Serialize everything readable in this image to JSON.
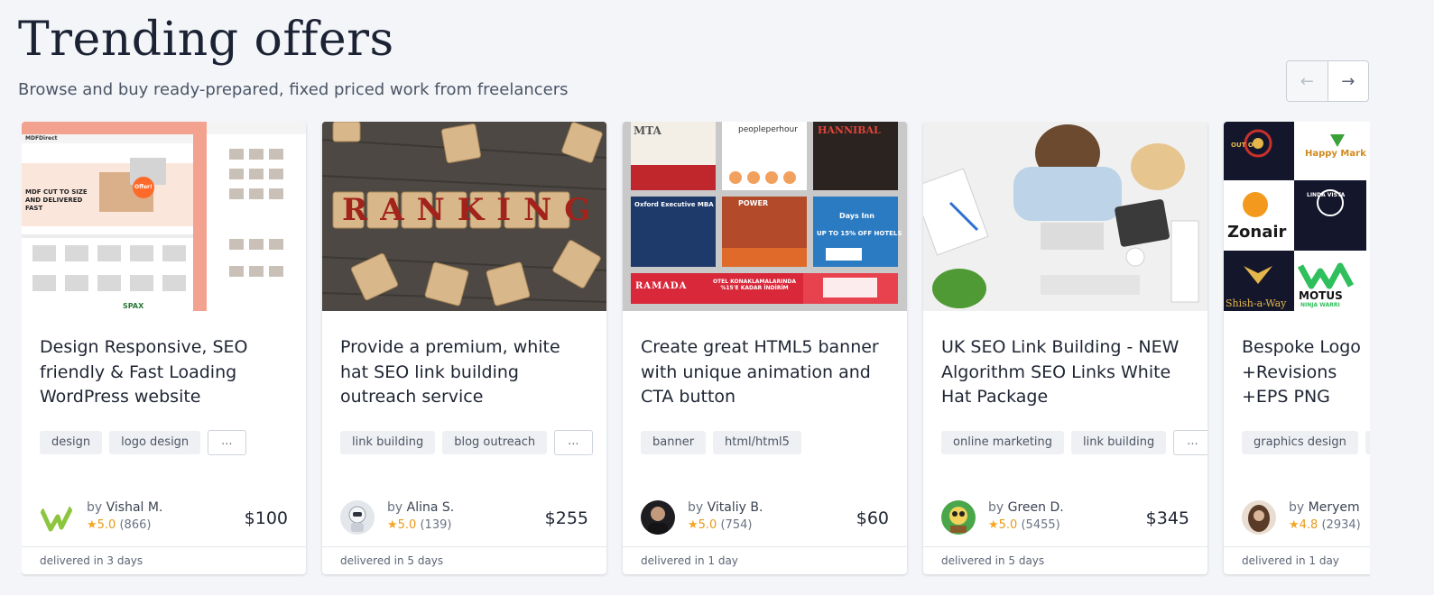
{
  "header": {
    "title": "Trending offers",
    "subtitle": "Browse and buy ready-prepared, fixed priced work from freelancers"
  },
  "nav": {
    "prev_icon": "←",
    "next_icon": "→"
  },
  "cards": [
    {
      "title": "Design Responsive, SEO friendly & Fast Loading WordPress website",
      "tags": [
        "design",
        "logo design",
        "..."
      ],
      "by": "by",
      "author": "Vishal M.",
      "star": "★",
      "rating": "5.0",
      "reviews": "(866)",
      "price": "$100",
      "delivery": "delivered in 3 days",
      "thumb_text": {
        "headline": "MDF CUT TO SIZE AND DELIVERED FAST",
        "badge": "Offer!",
        "brand": "MDFDirect",
        "footer_brand": "SPAX"
      }
    },
    {
      "title": "Provide a premium, white hat SEO link building outreach service",
      "tags": [
        "link building",
        "blog outreach",
        "..."
      ],
      "by": "by",
      "author": "Alina S.",
      "star": "★",
      "rating": "5.0",
      "reviews": "(139)",
      "price": "$255",
      "delivery": "delivered in 5 days",
      "thumb_text": {
        "word": "RANKING"
      }
    },
    {
      "title": "Create great HTML5 banner with unique animation and CTA button",
      "tags": [
        "banner",
        "html/html5"
      ],
      "by": "by",
      "author": "Vitaliy B.",
      "star": "★",
      "rating": "5.0",
      "reviews": "(754)",
      "price": "$60",
      "delivery": "delivered in 1 day",
      "thumb_text": {
        "mta": "MTA",
        "pph": "peopleperhour",
        "hannibal": "HANNIBAL",
        "oxford": "Oxford Executive MBA",
        "power": "POWER",
        "daysinn": "Days Inn",
        "offer": "UP TO 15% OFF HOTELS",
        "ramada": "RAMADA",
        "otel": "OTEL KONAKLAMALARINDA %15'E KADAR İNDİRİM"
      }
    },
    {
      "title": "UK SEO Link Building - NEW Algorithm SEO Links White Hat Package",
      "tags": [
        "online marketing",
        "link building",
        "..."
      ],
      "by": "by",
      "author": "Green D.",
      "star": "★",
      "rating": "5.0",
      "reviews": "(5455)",
      "price": "$345",
      "delivery": "delivered in 5 days",
      "thumb_text": {}
    },
    {
      "title": "Bespoke Logo +Revisions +EPS PNG",
      "tags": [
        "graphics design",
        ""
      ],
      "by": "by",
      "author": "Meryem",
      "star": "★",
      "rating": "4.8",
      "reviews": "(2934)",
      "price": "",
      "delivery": "delivered in 1 day",
      "thumb_text": {
        "l1": "OUT OUT",
        "l2": "Happy Mark",
        "l3": "Zonair",
        "l4": "LINDA VISTA",
        "l5": "Shish-a-Way",
        "l6": "MOTUS",
        "l6b": "NINJA WARRI"
      }
    }
  ],
  "colors": {
    "background": "#f3f5f8",
    "star": "#f5a623",
    "text": "#1f2533",
    "muted": "#6a7282"
  }
}
